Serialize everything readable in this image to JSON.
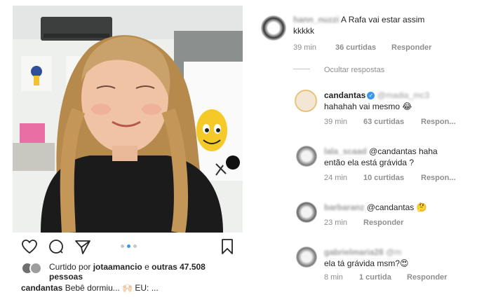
{
  "post": {
    "liked_by_prefix": "Curtido por",
    "liked_by_user": "jotaamancio",
    "liked_by_sep": "e",
    "liked_by_others": "outras 47.508",
    "liked_by_suffix": "pessoas",
    "caption_user": "candantas",
    "caption_text": "Bebê dormiu... 🙌🏻 EU: ..."
  },
  "icons": {
    "like": "heart-icon",
    "comment": "comment-icon",
    "share": "share-icon",
    "save": "bookmark-icon"
  },
  "comments": [
    {
      "user": "hann_nuzzi",
      "text": "A Rafa vai estar assim",
      "text2": "kkkkk",
      "time": "39 min",
      "likes": "36 curtidas",
      "reply": "Responder"
    },
    {
      "hide_replies": "Ocultar respostas"
    },
    {
      "user": "candantas",
      "mention": "@madia_mc3",
      "text": "hahahah vai mesmo 😂",
      "time": "39 min",
      "likes": "63 curtidas",
      "reply": "Respon..."
    },
    {
      "user": "lala_scaad",
      "mention": "@candantas",
      "text_tail": "haha",
      "text2": "então ela está grávida ?",
      "time": "24 min",
      "likes": "10 curtidas",
      "reply": "Respon..."
    },
    {
      "user": "barbaranz",
      "mention": "@candantas",
      "emoji": "🤔",
      "time": "23 min",
      "reply": "Responder"
    },
    {
      "user": "gabrielmaria28",
      "mention": "@m",
      "text2": "ela tá grávida msm?😍",
      "time": "8 min",
      "likes": "1 curtida",
      "reply": "Responder"
    }
  ],
  "colors": {
    "text": "#262626",
    "muted": "#8e8e8e",
    "verified": "#3897f0",
    "carousel_dot_active": "#3897f0"
  }
}
